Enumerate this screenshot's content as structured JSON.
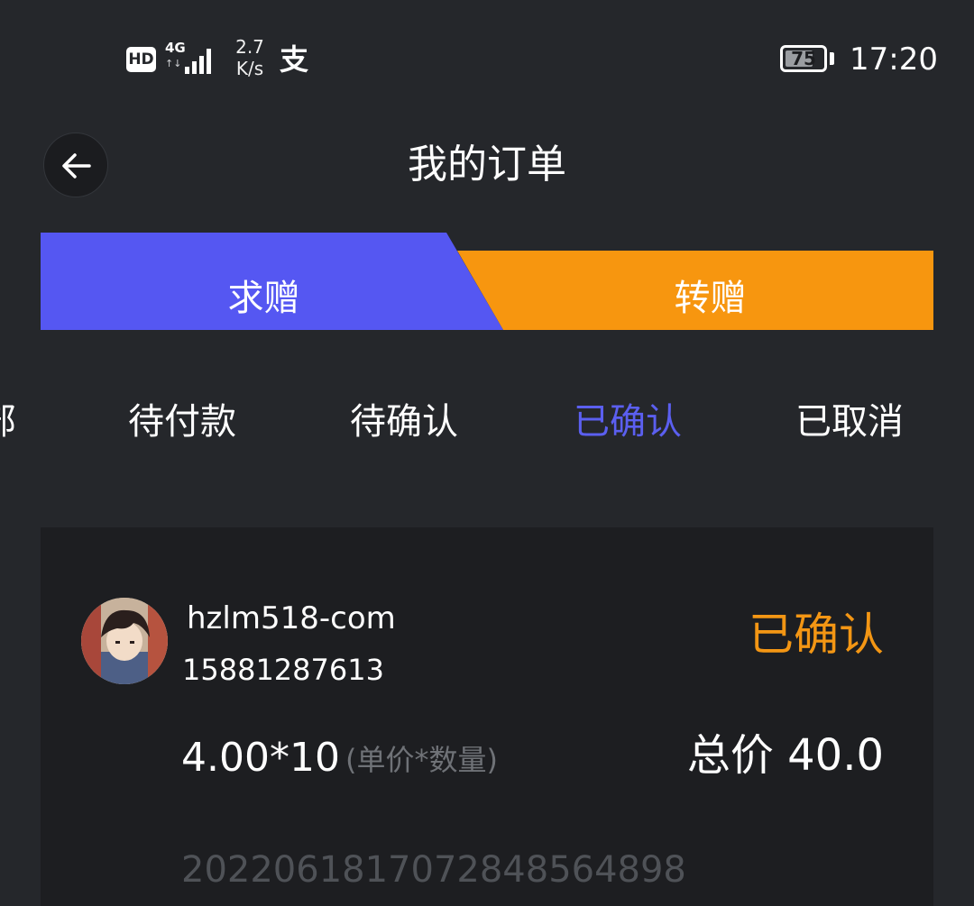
{
  "status_bar": {
    "hd": "HD",
    "network": "4G",
    "speed_value": "2.7",
    "speed_unit": "K/s",
    "alipay_glyph": "支",
    "battery": "75",
    "battery_level": 0.75,
    "time": "17:20"
  },
  "header": {
    "title": "我的订单",
    "back_icon": "arrow-left-icon"
  },
  "segments": {
    "left": "求赠",
    "right": "转赠",
    "left_color": "#5557f2",
    "right_color": "#f7960f"
  },
  "tabs": {
    "items": [
      "部",
      "待付款",
      "待确认",
      "已确认",
      "已取消"
    ],
    "active_index": 3,
    "active_color": "#5b5ff0"
  },
  "order": {
    "username": "hzlm518-com",
    "phone": "15881287613",
    "status": "已确认",
    "status_color": "#f39614",
    "price_qty": "4.00*10",
    "price_hint": "(单价*数量)",
    "total": "总价 40.0",
    "order_no": "20220618170728485648​98"
  }
}
